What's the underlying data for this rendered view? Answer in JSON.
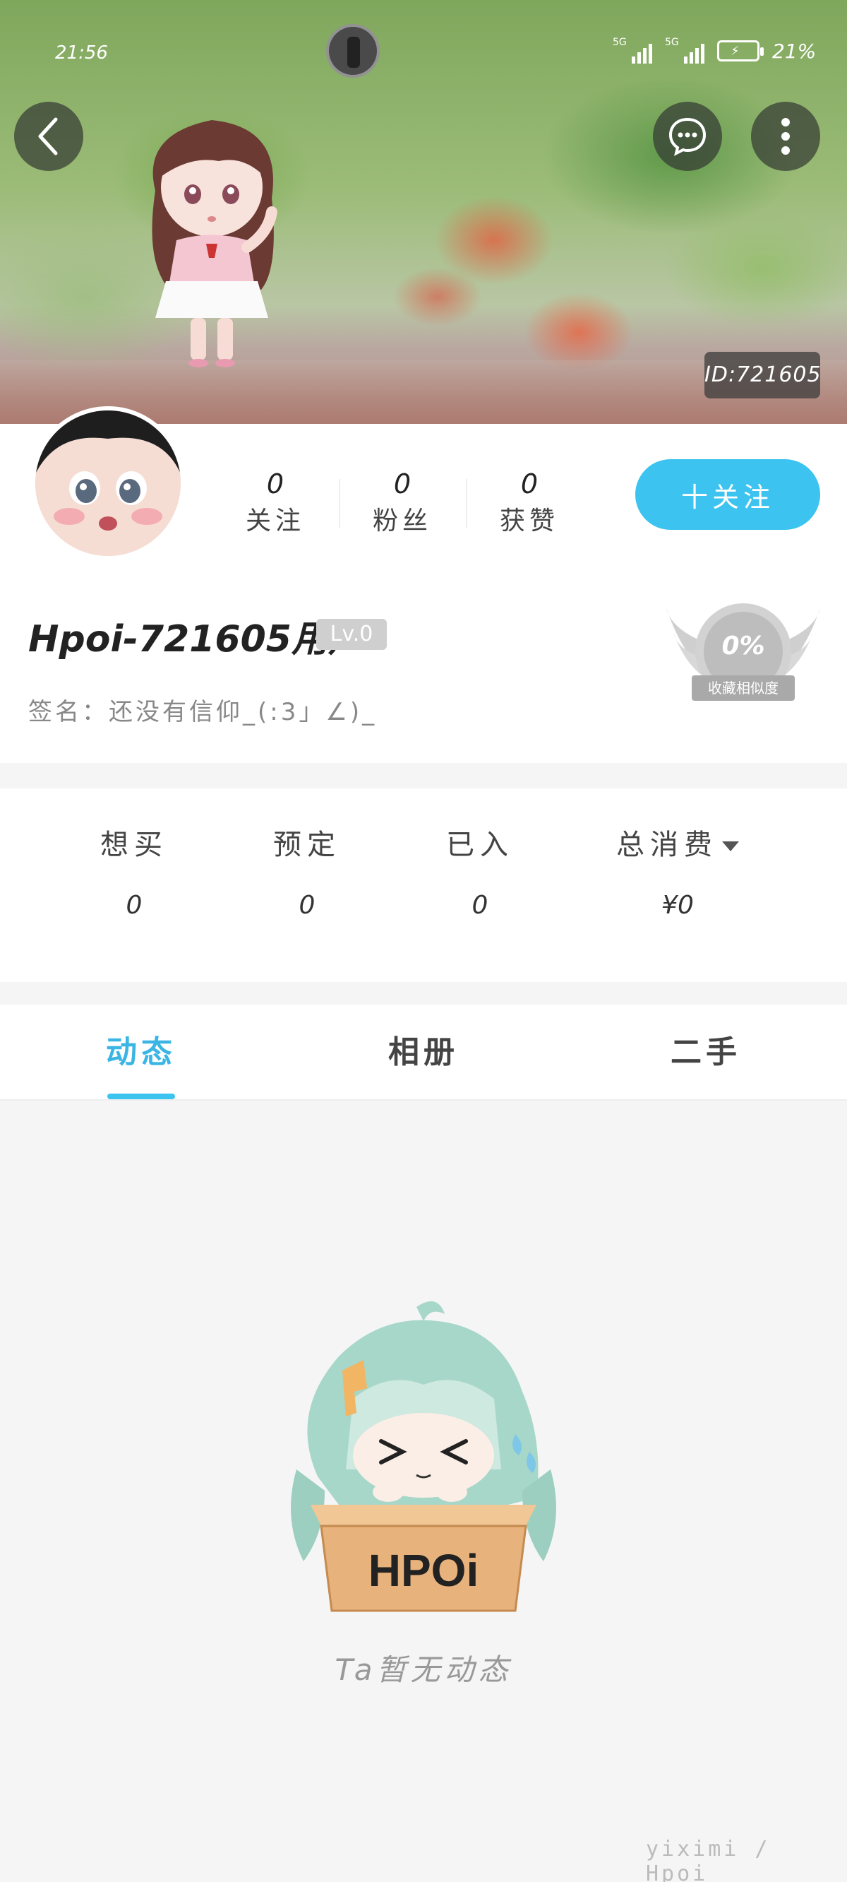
{
  "status_bar": {
    "time": "21:56",
    "network_1": "5G",
    "network_2": "5G",
    "battery": "21%"
  },
  "cover": {
    "id_label": "ID:721605"
  },
  "profile": {
    "stats": [
      {
        "value": "0",
        "label": "关注"
      },
      {
        "value": "0",
        "label": "粉丝"
      },
      {
        "value": "0",
        "label": "获赞"
      }
    ],
    "follow_label": "十关注",
    "username": "Hpoi-721605用户",
    "level": "Lv.0",
    "signature": "签名：还没有信仰_(:3」∠)_",
    "similarity_percent": "0%",
    "similarity_label": "收藏相似度"
  },
  "collection": [
    {
      "label": "想买",
      "value": "0"
    },
    {
      "label": "预定",
      "value": "0"
    },
    {
      "label": "已入",
      "value": "0"
    },
    {
      "label": "总消费",
      "value": "¥0"
    }
  ],
  "tabs": [
    {
      "label": "动态",
      "active": true
    },
    {
      "label": "相册",
      "active": false
    },
    {
      "label": "二手",
      "active": false
    }
  ],
  "empty_state": {
    "text": "Ta暂无动态",
    "mascot_text": "HPOi"
  },
  "watermark": "yiximi / Hpoi",
  "colors": {
    "accent": "#3cc3f0",
    "tab_active": "#3bb5e4"
  }
}
